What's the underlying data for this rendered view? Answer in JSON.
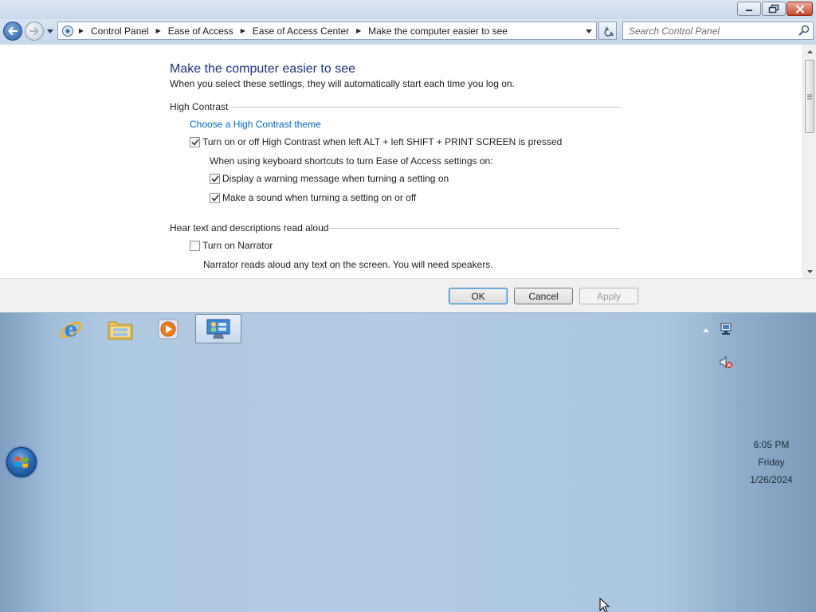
{
  "window": {
    "caption_buttons": {
      "minimize": "minimize",
      "maximize": "restore",
      "close": "close"
    },
    "breadcrumb": [
      "Control Panel",
      "Ease of Access",
      "Ease of Access Center",
      "Make the computer easier to see"
    ],
    "search": {
      "placeholder": "Search Control Panel"
    }
  },
  "content": {
    "title": "Make the computer easier to see",
    "subtitle": "When you select these settings, they will automatically start each time you log on.",
    "sections": {
      "high_contrast": {
        "heading": "High Contrast",
        "link": "Choose a High Contrast theme",
        "toggle_label": "Turn on or off High Contrast when left ALT + left SHIFT + PRINT SCREEN is pressed",
        "toggle_checked": true,
        "shortcut_note": "When using keyboard shortcuts to turn Ease of Access settings on:",
        "warning_label": "Display a warning message when turning a setting on",
        "warning_checked": true,
        "sound_label": "Make a sound when turning a setting on or off",
        "sound_checked": true
      },
      "narrator": {
        "heading": "Hear text and descriptions read aloud",
        "toggle_label": "Turn on Narrator",
        "toggle_checked": false,
        "description": "Narrator reads aloud any text on the screen. You will need speakers."
      }
    }
  },
  "buttons": {
    "ok": "OK",
    "cancel": "Cancel",
    "apply": "Apply",
    "apply_enabled": false
  },
  "taskbar": {
    "pinned": [
      {
        "name": "Internet Explorer",
        "icon": "ie-icon"
      },
      {
        "name": "Windows Explorer",
        "icon": "folder-icon"
      },
      {
        "name": "Windows Media Player",
        "icon": "media-player-icon"
      },
      {
        "name": "Ease of Access Center",
        "icon": "control-panel-icon",
        "active": true
      }
    ],
    "tray": {
      "network_icon": "network-icon",
      "volume_icon": "volume-muted-icon"
    },
    "clock": {
      "time": "6:05 PM",
      "day": "Friday",
      "date": "1/26/2024"
    }
  },
  "colors": {
    "title": "#1e3287",
    "link": "#0066cc",
    "desktop": "#b3cbe3"
  }
}
